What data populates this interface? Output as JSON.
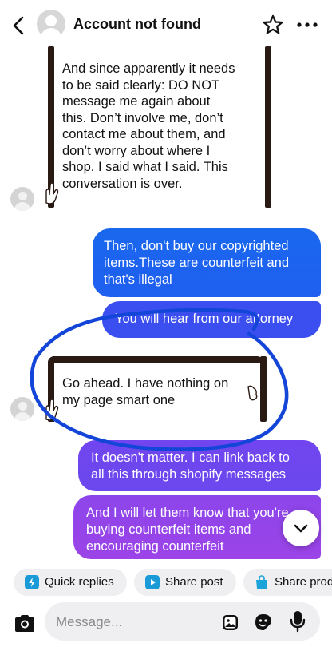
{
  "header": {
    "title": "Account not found"
  },
  "messages": [
    {
      "direction": "incoming",
      "lines": [
        "And since apparently it needs",
        "to be said clearly: DO NOT",
        "message me again about",
        "this. Don’t involve me, don’t",
        "contact me about them, and",
        "don’t worry about where I",
        "shop. I said what I said. This",
        "conversation is over."
      ]
    },
    {
      "direction": "outgoing",
      "lines": [
        "Then, don't buy our copyrighted",
        "items.These are counterfeit and",
        "that's illegal"
      ]
    },
    {
      "direction": "outgoing",
      "lines": [
        "You will hear from our attorney"
      ]
    },
    {
      "direction": "incoming",
      "lines": [
        "Go ahead. I have nothing on",
        "my page smart one"
      ]
    },
    {
      "direction": "outgoing",
      "lines": [
        "It doesn't matter. I can link back to",
        "all this through shopify messages"
      ]
    },
    {
      "direction": "outgoing",
      "lines": [
        "And I will let them know that you're",
        "buying counterfeit items and",
        "encouraging counterfeit"
      ]
    }
  ],
  "chips": [
    {
      "label": "Quick replies",
      "icon": "quick-replies-icon",
      "color": "#1a9bd7"
    },
    {
      "label": "Share post",
      "icon": "share-post-icon",
      "color": "#1a9bd7"
    },
    {
      "label": "Share prod",
      "icon": "shopping-bag-icon",
      "color": "#1aa3d9"
    }
  ],
  "composer": {
    "placeholder": "Message..."
  },
  "colors": {
    "outgoing_blue": "#1f62ef",
    "outgoing_purple": "#8c45ea",
    "scribble": "#1346d8",
    "scroll_frame": "#2a1a14"
  }
}
